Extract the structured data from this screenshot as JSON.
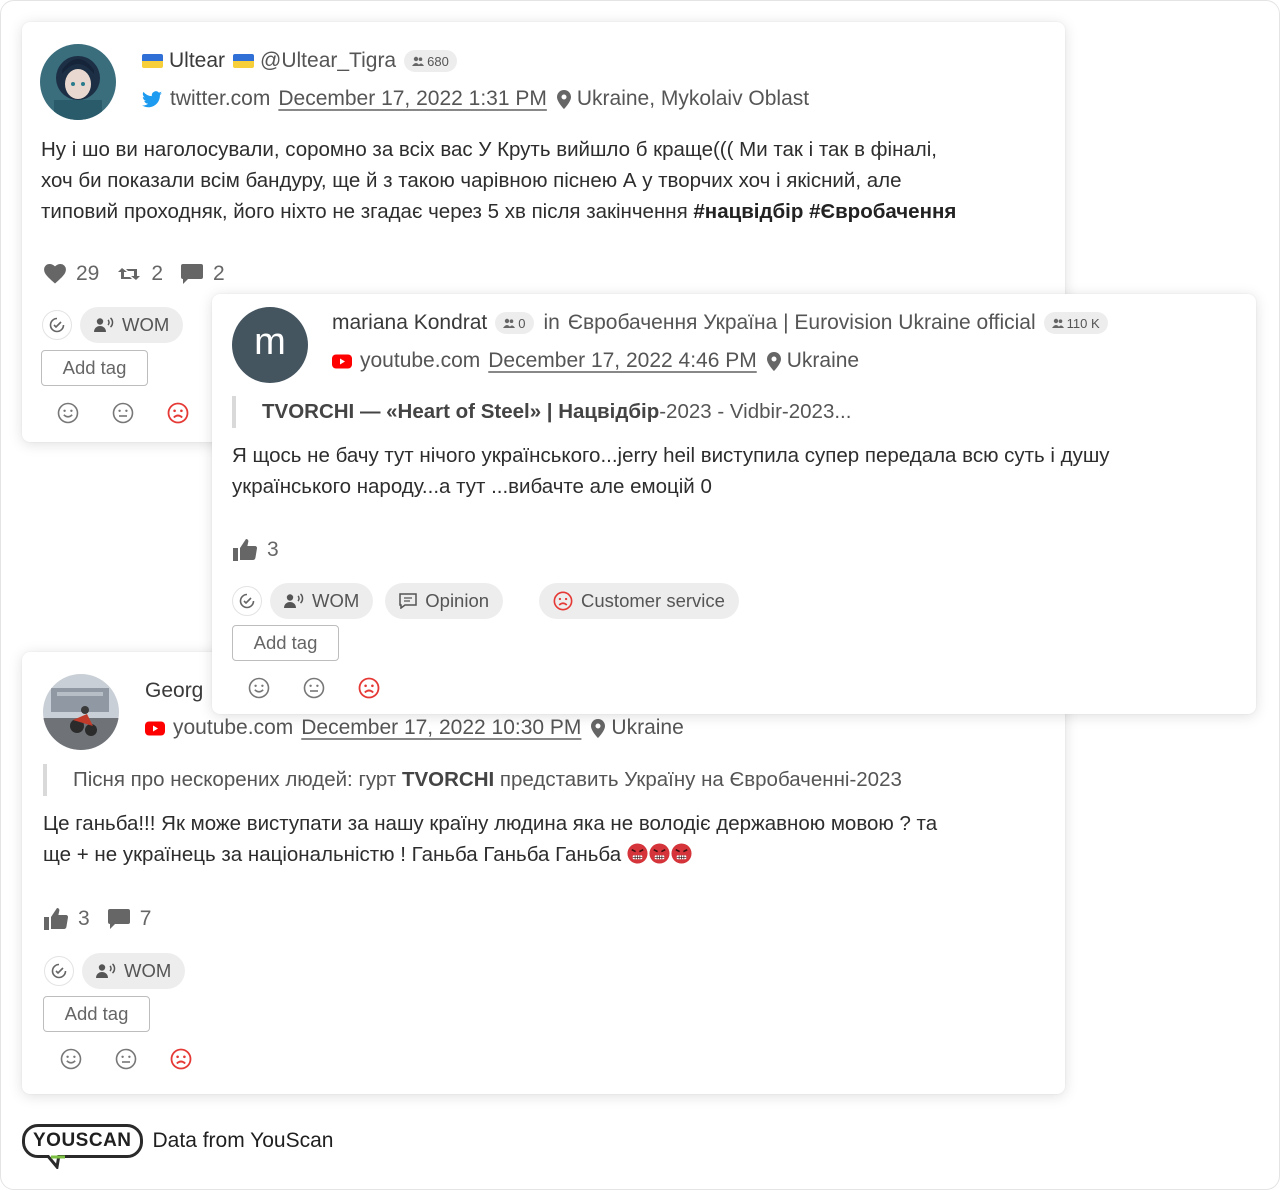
{
  "posts": [
    {
      "author": "Ultear",
      "handle": "@Ultear_Tigra",
      "audience": "680",
      "source": "twitter.com",
      "date": "December 17, 2022 1:31 PM",
      "location": "Ukraine, Mykolaiv Oblast",
      "text_line1": "Ну і шо ви наголосували, соромно за всіх вас У Круть вийшло б краще((( Ми так і так в фіналі,",
      "text_line2": "хоч би показали всім бандуру, ще й з такою чарівною піснею А у творчих хоч і якісний, але",
      "text_line3": "типовий проходняк, його ніхто не згадає через 5 хв після закінчення ",
      "hashtags": "#нацвідбір #Євробачення",
      "likes": "29",
      "reposts": "2",
      "comments": "2",
      "tags": [
        "WOM"
      ],
      "add_tag": "Add tag"
    },
    {
      "author": "mariana Kondrat",
      "avatar_letter": "m",
      "audience": "0",
      "in_label": "in",
      "channel": "Євробачення Україна | Eurovision Ukraine official",
      "channel_audience": "110 K",
      "source": "youtube.com",
      "date": "December 17, 2022 4:46 PM",
      "location": "Ukraine",
      "quote_a": "TVORCHI — «Heart of Steel» | Нацвідбір",
      "quote_b": "-2023 - Vidbir-2023...",
      "text_line1": "Я щось не бачу тут нічого українського...jerry heil виступила супер передала всю суть і душу",
      "text_line2": "українського народу...а тут ...вибачте але емоцій 0",
      "likes": "3",
      "tags": [
        "WOM",
        "Opinion"
      ],
      "category": "Customer service",
      "add_tag": "Add tag"
    },
    {
      "author": "Georg",
      "source": "youtube.com",
      "date": "December 17, 2022 10:30 PM",
      "location": "Ukraine",
      "quote_a": "Пісня про нескорених людей: гурт ",
      "quote_b": "TVORCHI",
      "quote_c": " представить Україну на Євробаченні-2023",
      "text_line1": "Це ганьба!!! Як може виступати за нашу країну людина яка не володіє державною мовою ? та",
      "text_line2": "ще + не українець за національністю ! Ганьба Ганьба Ганьба ",
      "likes": "3",
      "comments": "7",
      "tags": [
        "WOM"
      ],
      "add_tag": "Add tag"
    }
  ],
  "footer": {
    "logo": "YOUSCAN",
    "text": "Data from YouScan"
  },
  "colors": {
    "negative": "#e53935",
    "twitter": "#1d9bf0",
    "youtube": "#ff0000",
    "chip": "#ededed",
    "neutral_icon": "#777777"
  }
}
